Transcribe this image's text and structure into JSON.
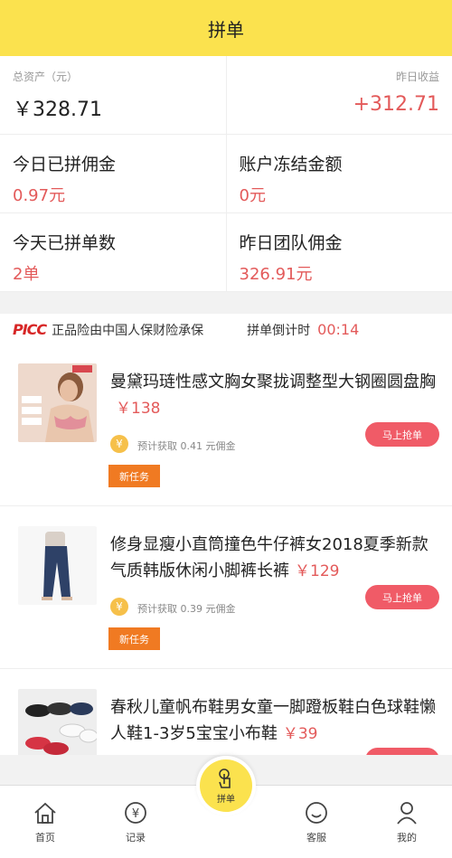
{
  "header": {
    "title": "拼单"
  },
  "assets": {
    "total_label": "总资产（元）",
    "total_value": "￥328.71",
    "yesterday_label": "昨日收益",
    "yesterday_value": "+312.71"
  },
  "stats": [
    {
      "label": "今日已拼佣金",
      "value": "0.97元"
    },
    {
      "label": "账户冻结金额",
      "value": "0元"
    },
    {
      "label": "今天已拼单数",
      "value": "2单"
    },
    {
      "label": "昨日团队佣金",
      "value": "326.91元"
    }
  ],
  "insurance": {
    "logo": "PICC",
    "text": "正品险由中国人保财险承保",
    "countdown_label": "拼单倒计时",
    "countdown_value": "00:14"
  },
  "products": [
    {
      "title": "曼黛玛琏性感文胸女聚拢调整型大钢圈圆盘胸",
      "price": "￥138",
      "estimate": "预计获取 0.41 元佣金",
      "grab": "马上抢单",
      "tag": "新任务"
    },
    {
      "title": "修身显瘦小直筒撞色牛仔裤女2018夏季新款气质韩版休闲小脚裤长裤",
      "price": "￥129",
      "estimate": "预计获取 0.39 元佣金",
      "grab": "马上抢单",
      "tag": "新任务"
    },
    {
      "title": "春秋儿童帆布鞋男女童一脚蹬板鞋白色球鞋懒人鞋1-3岁5宝宝小布鞋",
      "price": "￥39",
      "estimate": "",
      "grab": "",
      "tag": ""
    }
  ],
  "tabs": [
    {
      "label": "首页",
      "icon": "home-icon"
    },
    {
      "label": "记录",
      "icon": "yen-record-icon"
    },
    {
      "label": "拼单",
      "icon": "tap-hand-icon"
    },
    {
      "label": "客服",
      "icon": "smiley-icon"
    },
    {
      "label": "我的",
      "icon": "user-icon"
    }
  ],
  "colors": {
    "accent": "#fbe24e",
    "red": "#e35a5a",
    "button": "#f05b67",
    "tag": "#f07a22"
  }
}
